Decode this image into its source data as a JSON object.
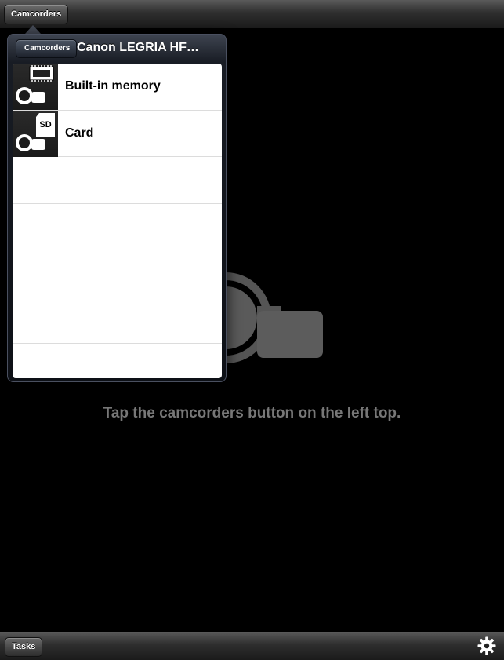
{
  "topbar": {
    "camcorders_button": "Camcorders"
  },
  "popover": {
    "back_button": "Camcorders",
    "title": "Canon LEGRIA HF…",
    "items": [
      {
        "label": "Built-in memory",
        "icon": "memory-chip-camcorder-icon"
      },
      {
        "label": "Card",
        "icon": "sd-card-camcorder-icon"
      }
    ],
    "card_icon_text": "SD"
  },
  "main": {
    "hint": "Tap the camcorders button on the left top."
  },
  "bottombar": {
    "tasks_button": "Tasks",
    "settings_icon": "gear-icon"
  }
}
